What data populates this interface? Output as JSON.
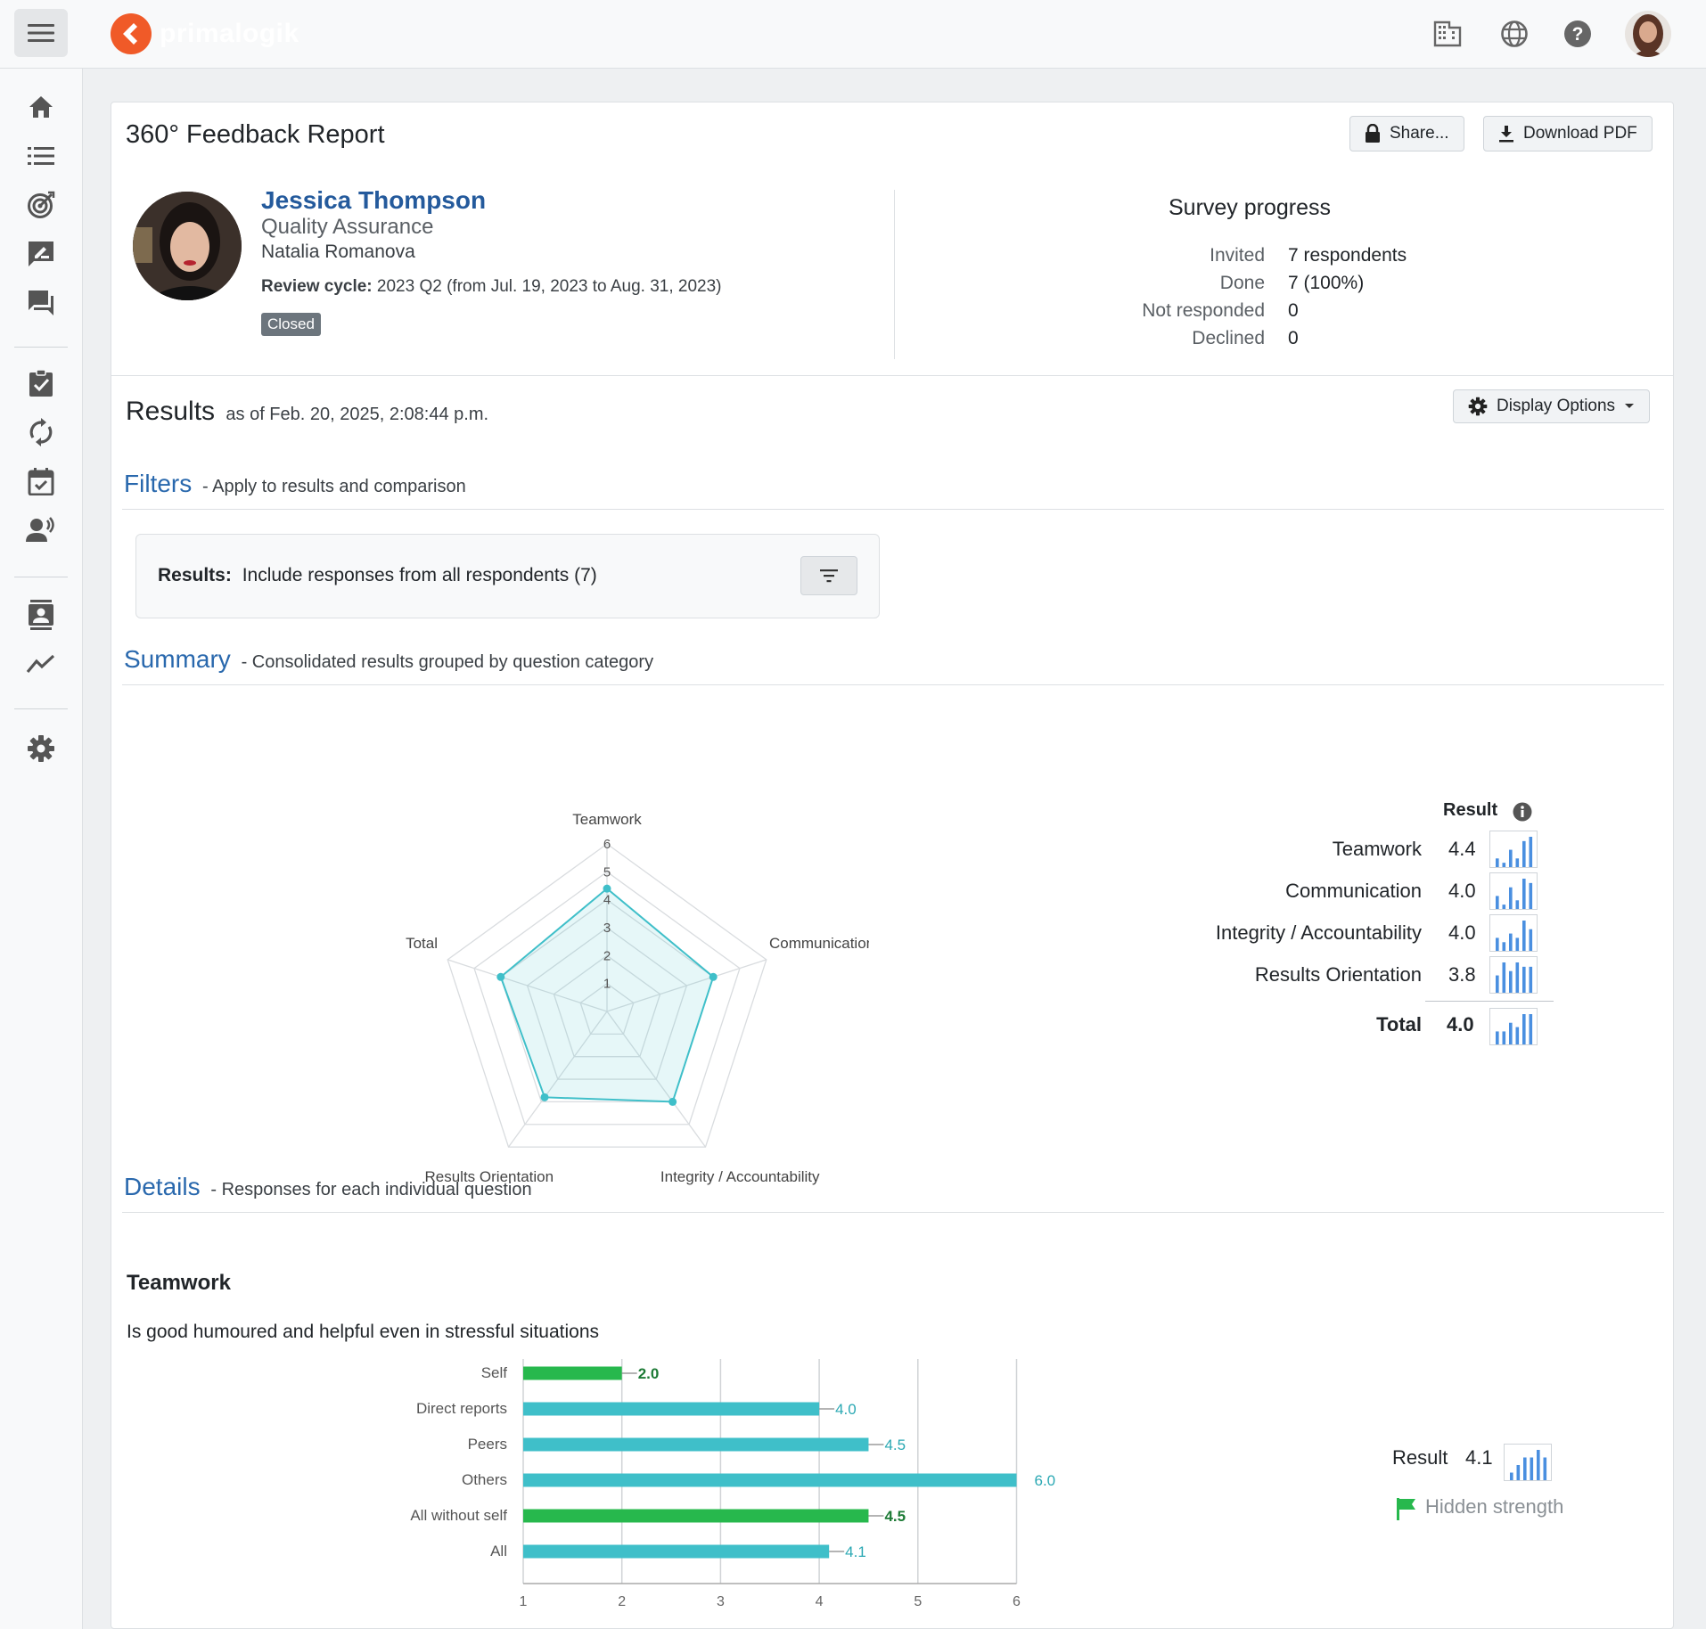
{
  "app": {
    "logo_text": "primalogik"
  },
  "report": {
    "title": "360° Feedback Report",
    "share_label": "Share...",
    "download_label": "Download PDF"
  },
  "person": {
    "name": "Jessica Thompson",
    "department": "Quality Assurance",
    "manager": "Natalia Romanova",
    "cycle_label": "Review cycle:",
    "cycle_value": "2023 Q2 (from Jul. 19, 2023 to Aug. 31, 2023)",
    "status": "Closed"
  },
  "survey_progress": {
    "title": "Survey progress",
    "rows": [
      {
        "label": "Invited",
        "value": "7 respondents"
      },
      {
        "label": "Done",
        "value": "7 (100%)"
      },
      {
        "label": "Not responded",
        "value": "0"
      },
      {
        "label": "Declined",
        "value": "0"
      }
    ]
  },
  "results": {
    "title": "Results",
    "as_of": "as of Feb. 20, 2025, 2:08:44 p.m.",
    "display_options_label": "Display Options"
  },
  "filters": {
    "title": "Filters",
    "subtitle": "- Apply to results and comparison",
    "results_label": "Results:",
    "results_text": "Include responses from all respondents (7)"
  },
  "summary": {
    "title": "Summary",
    "subtitle": "- Consolidated results grouped by question category",
    "result_header": "Result",
    "rows": [
      {
        "label": "Teamwork",
        "value": "4.4",
        "dist": [
          2,
          1,
          4,
          2,
          6,
          7
        ]
      },
      {
        "label": "Communication",
        "value": "4.0",
        "dist": [
          3,
          1,
          5,
          2,
          7,
          6
        ]
      },
      {
        "label": "Integrity / Accountability",
        "value": "4.0",
        "dist": [
          3,
          2,
          4,
          3,
          7,
          5
        ]
      },
      {
        "label": "Results Orientation",
        "value": "3.8",
        "dist": [
          4,
          7,
          5,
          7,
          6,
          6
        ]
      }
    ],
    "total_label": "Total",
    "total_value": "4.0",
    "total_dist": [
      3,
      3,
      5,
      4,
      7,
      7
    ]
  },
  "details": {
    "title": "Details",
    "subtitle": "- Responses for each individual question",
    "category": "Teamwork",
    "question": "Is good humoured and helpful even in stressful situations",
    "result_label": "Result",
    "result_value": "4.1",
    "result_dist": [
      1,
      2,
      3,
      3,
      4,
      3
    ],
    "flag_label": "Hidden strength"
  },
  "colors": {
    "accent": "#2968ad",
    "teal": "#3fbfc9",
    "green": "#27b84d",
    "spark": "#4a8fe0"
  },
  "chart_data": [
    {
      "type": "radar",
      "categories": [
        "Teamwork",
        "Communication",
        "Integrity / Accountability",
        "Results Orientation",
        "Total"
      ],
      "values": [
        4.4,
        4.0,
        4.0,
        3.8,
        4.0
      ],
      "ticks": [
        "1",
        "2",
        "3",
        "4",
        "5",
        "6"
      ],
      "rlim": [
        0,
        6
      ]
    },
    {
      "type": "bar",
      "orientation": "horizontal",
      "categories": [
        "Self",
        "Direct reports",
        "Peers",
        "Others",
        "All without self",
        "All"
      ],
      "values": [
        2.0,
        4.0,
        4.5,
        6.0,
        4.5,
        4.1
      ],
      "labels": [
        "2.0",
        "4.0",
        "4.5",
        "6.0",
        "4.5",
        "4.1"
      ],
      "highlight": [
        true,
        false,
        false,
        false,
        true,
        false
      ],
      "xticks": [
        "1",
        "2",
        "3",
        "4",
        "5",
        "6"
      ],
      "xlim": [
        1,
        6
      ]
    }
  ]
}
